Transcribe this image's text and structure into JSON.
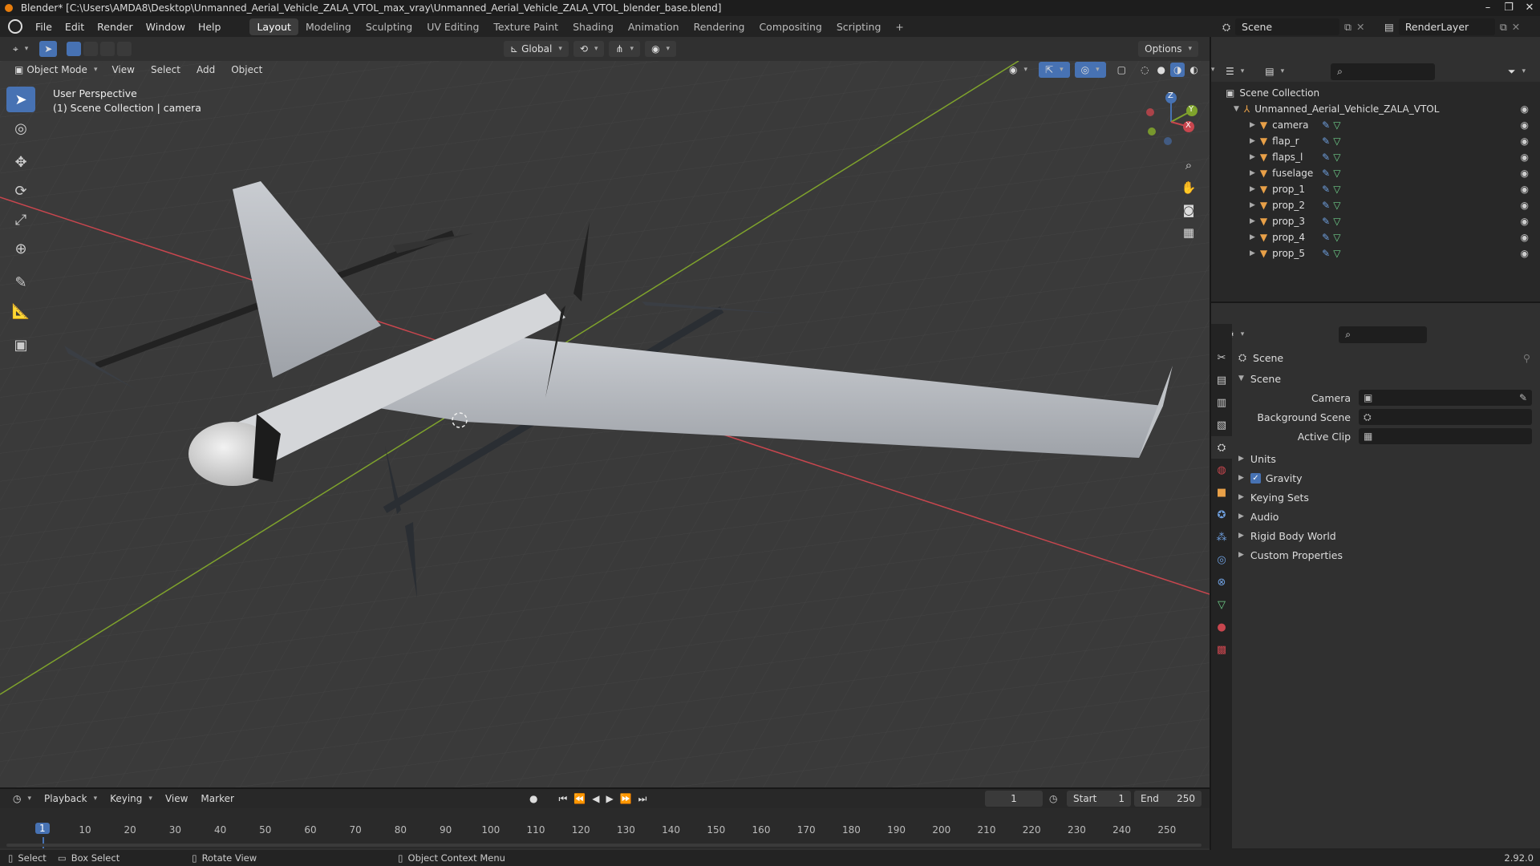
{
  "window": {
    "title": "Blender* [C:\\Users\\AMDA8\\Desktop\\Unmanned_Aerial_Vehicle_ZALA_VTOL_max_vray\\Unmanned_Aerial_Vehicle_ZALA_VTOL_blender_base.blend]",
    "controls": [
      "–",
      "❐",
      "✕"
    ]
  },
  "menu": {
    "items": [
      "File",
      "Edit",
      "Render",
      "Window",
      "Help"
    ],
    "workspaces": [
      "Layout",
      "Modeling",
      "Sculpting",
      "UV Editing",
      "Texture Paint",
      "Shading",
      "Animation",
      "Rendering",
      "Compositing",
      "Scripting"
    ],
    "active_workspace": "Layout",
    "add_workspace": "+",
    "scene_name": "Scene",
    "view_layer": "RenderLayer"
  },
  "viewport_header": {
    "transform_orientation": "Global",
    "options": "Options",
    "mode": "Object Mode",
    "menus": [
      "View",
      "Select",
      "Add",
      "Object"
    ]
  },
  "viewport": {
    "perspective": "User Perspective",
    "collection_info": "(1) Scene Collection | camera",
    "gizmo_axes": [
      "Z",
      "Y",
      "X"
    ]
  },
  "outliner": {
    "root": "Scene Collection",
    "collection": "Unmanned_Aerial_Vehicle_ZALA_VTOL",
    "objects": [
      "camera",
      "flap_r",
      "flaps_l",
      "fuselage",
      "prop_1",
      "prop_2",
      "prop_3",
      "prop_4",
      "prop_5"
    ]
  },
  "properties": {
    "context": "Scene",
    "panel": "Scene",
    "fields": [
      {
        "label": "Camera",
        "value": ""
      },
      {
        "label": "Background Scene",
        "value": ""
      },
      {
        "label": "Active Clip",
        "value": ""
      }
    ],
    "sections": [
      "Units",
      "Gravity",
      "Keying Sets",
      "Audio",
      "Rigid Body World",
      "Custom Properties"
    ],
    "gravity_checked": true
  },
  "timeline": {
    "menus": [
      "Playback",
      "Keying",
      "View",
      "Marker"
    ],
    "current_frame": "1",
    "start_label": "Start",
    "start": "1",
    "end_label": "End",
    "end": "250",
    "ticks": [
      "10",
      "20",
      "30",
      "40",
      "50",
      "60",
      "70",
      "80",
      "90",
      "100",
      "110",
      "120",
      "130",
      "140",
      "150",
      "160",
      "170",
      "180",
      "190",
      "200",
      "210",
      "220",
      "230",
      "240",
      "250"
    ],
    "frame_marker": "1"
  },
  "status": {
    "select": "Select",
    "box_select": "Box Select",
    "rotate_view": "Rotate View",
    "context_menu": "Object Context Menu",
    "version": "2.92.0"
  },
  "colors": {
    "accent": "#4772b3",
    "x_axis": "#c8464e",
    "y_axis": "#7fa32c",
    "object_icon": "#e8a048",
    "mesh_icon": "#6fcf8a"
  }
}
